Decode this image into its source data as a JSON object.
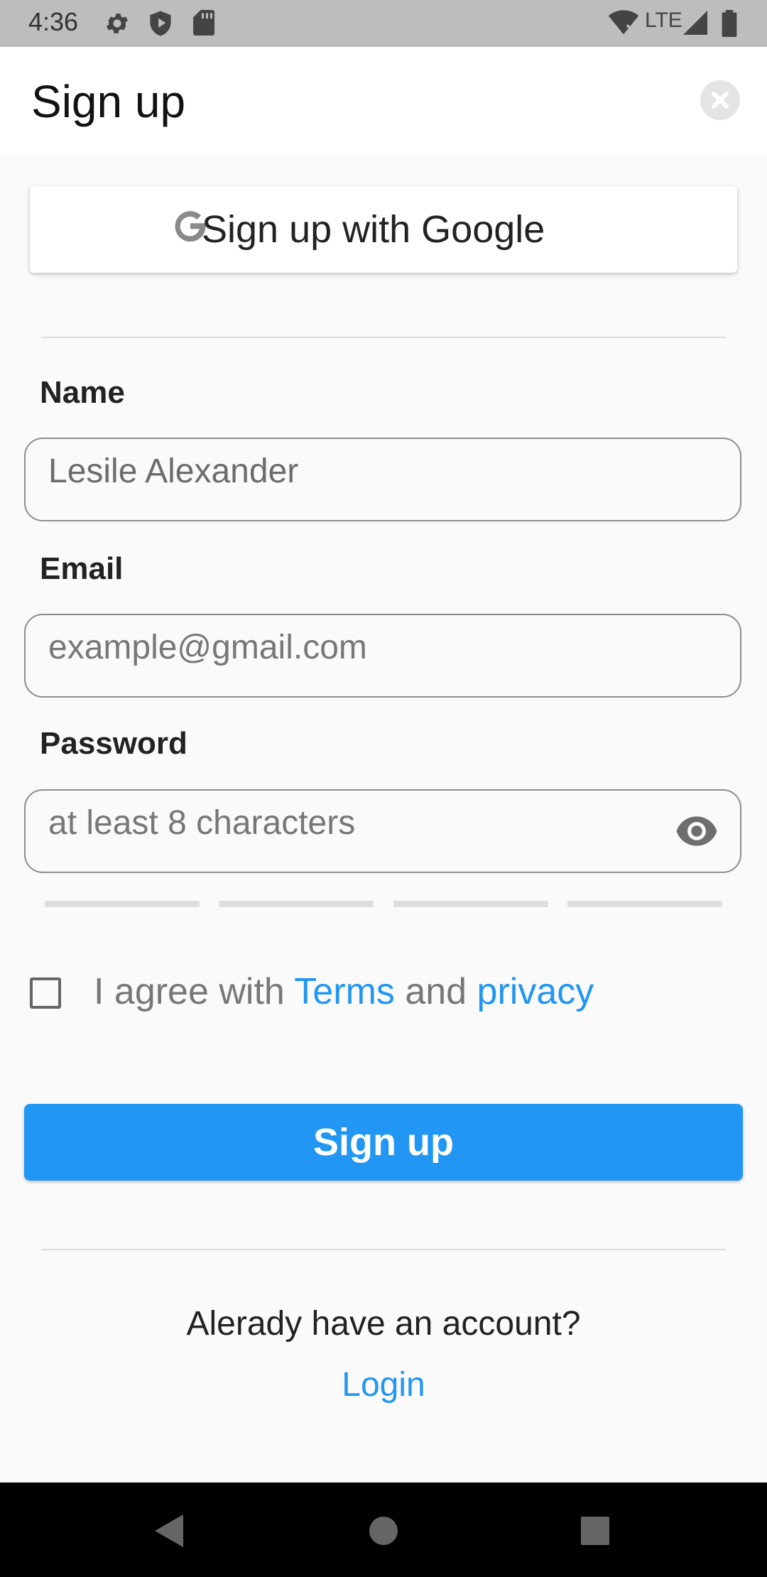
{
  "status_bar": {
    "time": "4:36",
    "network": "LTE",
    "icons": [
      "settings-icon",
      "shield-play-icon",
      "sd-card-icon",
      "wifi-icon",
      "signal-icon",
      "battery-icon"
    ]
  },
  "header": {
    "title": "Sign up",
    "close_icon": "close-icon"
  },
  "google_button": {
    "label": "Sign up with Google",
    "icon": "google-icon"
  },
  "form": {
    "name": {
      "label": "Name",
      "value": "Lesile Alexander",
      "placeholder": ""
    },
    "email": {
      "label": "Email",
      "value": "",
      "placeholder": "example@gmail.com"
    },
    "password": {
      "label": "Password",
      "value": "",
      "placeholder": "at least 8 characters",
      "icon": "eye-icon"
    }
  },
  "agreement": {
    "checked": false,
    "prefix": "I agree with ",
    "terms_link": "Terms",
    "middle": " and ",
    "privacy_link": "privacy"
  },
  "submit": {
    "label": "Sign up"
  },
  "footer": {
    "question": "Alerady have an account?",
    "login_link": "Login"
  },
  "colors": {
    "accent": "#2196f3",
    "status_bar": "#bdbdbd",
    "background": "#fafafa",
    "nav_bar": "#000000"
  },
  "nav_bar": {
    "icons": [
      "back-icon",
      "home-icon",
      "recents-icon"
    ]
  }
}
